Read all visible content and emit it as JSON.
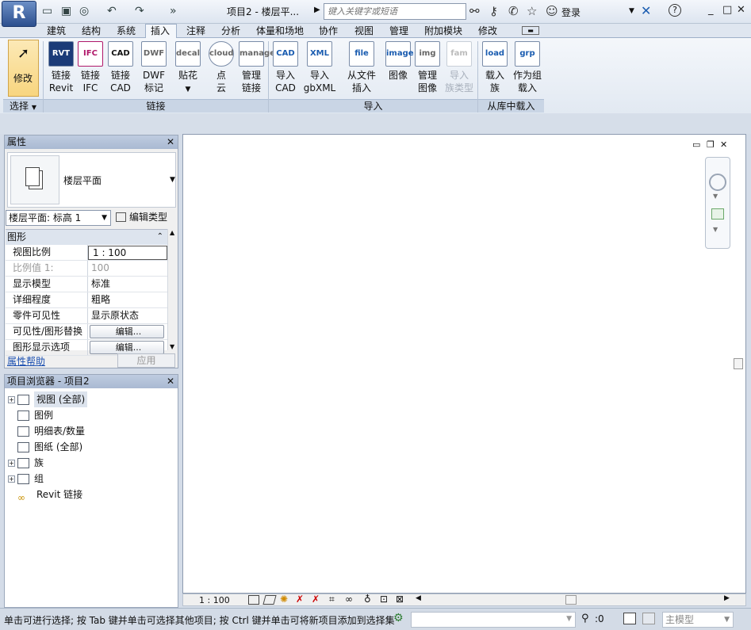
{
  "titlebar": {
    "app_letter": "R",
    "doc_title": "项目2 - 楼层平...",
    "search_placeholder": "键入关键字或短语",
    "login_label": "登录",
    "help_icon": "?",
    "window_buttons": [
      "_",
      "□",
      "✕"
    ]
  },
  "tabs": [
    "建筑",
    "结构",
    "系统",
    "插入",
    "注释",
    "分析",
    "体量和场地",
    "协作",
    "视图",
    "管理",
    "附加模块",
    "修改"
  ],
  "active_tab": "插入",
  "ribbon": {
    "modify": {
      "label": "修改",
      "group": "选择"
    },
    "link_group": {
      "label": "链接",
      "buttons": [
        {
          "l1": "链接",
          "l2": "Revit",
          "icon": "RVT"
        },
        {
          "l1": "链接",
          "l2": "IFC",
          "icon": "IFC"
        },
        {
          "l1": "链接",
          "l2": "CAD",
          "icon": "CAD"
        },
        {
          "l1": "DWF",
          "l2": "标记",
          "icon": "DWF"
        },
        {
          "l1": "贴花",
          "l2": "",
          "icon": "decal"
        },
        {
          "l1": "点",
          "l2": "云",
          "icon": "cloud"
        },
        {
          "l1": "管理",
          "l2": "链接",
          "icon": "manage"
        }
      ]
    },
    "import_group": {
      "label": "导入",
      "buttons": [
        {
          "l1": "导入",
          "l2": "CAD",
          "icon": "CAD",
          "disabled": false
        },
        {
          "l1": "导入",
          "l2": "gbXML",
          "icon": "XML",
          "disabled": false
        },
        {
          "l1": "从文件",
          "l2": "插入",
          "icon": "file",
          "disabled": false
        },
        {
          "l1": "图像",
          "l2": "",
          "icon": "image",
          "disabled": false
        },
        {
          "l1": "管理",
          "l2": "图像",
          "icon": "img",
          "disabled": false
        },
        {
          "l1": "导入",
          "l2": "族类型",
          "icon": "fam",
          "disabled": true
        }
      ]
    },
    "library_group": {
      "label": "从库中载入",
      "buttons": [
        {
          "l1": "载入",
          "l2": "族",
          "icon": "load"
        },
        {
          "l1": "作为组",
          "l2": "载入",
          "icon": "grp"
        }
      ]
    }
  },
  "properties": {
    "header": "属性",
    "type_name": "楼层平面",
    "instance_selector": "楼层平面: 标高 1",
    "edit_type": "编辑类型",
    "section": "图形",
    "rows": [
      {
        "key": "视图比例",
        "value": "1 : 100",
        "button": false,
        "dim": false
      },
      {
        "key": "比例值 1:",
        "value": "100",
        "button": false,
        "dim": true
      },
      {
        "key": "显示模型",
        "value": "标准",
        "button": false,
        "dim": false
      },
      {
        "key": "详细程度",
        "value": "粗略",
        "button": false,
        "dim": false
      },
      {
        "key": "零件可见性",
        "value": "显示原状态",
        "button": false,
        "dim": false
      },
      {
        "key": "可见性/图形替换",
        "value": "编辑...",
        "button": true,
        "dim": false
      },
      {
        "key": "图形显示选项",
        "value": "编辑...",
        "button": true,
        "dim": false
      }
    ],
    "help_link": "属性帮助",
    "apply": "应用"
  },
  "browser": {
    "header": "项目浏览器 - 项目2",
    "nodes": [
      {
        "label": "视图 (全部)",
        "expandable": true,
        "selected": true
      },
      {
        "label": "图例",
        "expandable": false,
        "selected": false
      },
      {
        "label": "明细表/数量",
        "expandable": false,
        "selected": false
      },
      {
        "label": "图纸 (全部)",
        "expandable": false,
        "selected": false
      },
      {
        "label": "族",
        "expandable": true,
        "selected": false
      },
      {
        "label": "组",
        "expandable": true,
        "selected": false
      },
      {
        "label": "Revit 链接",
        "expandable": false,
        "selected": false
      }
    ]
  },
  "viewcontrol": {
    "scale": "1 : 100"
  },
  "status": {
    "text": "单击可进行选择; 按 Tab 键并单击可选择其他项目; 按 Ctrl 键并单击可将新项目添加到选择集",
    "filter_count": ":0",
    "model": "主模型"
  }
}
